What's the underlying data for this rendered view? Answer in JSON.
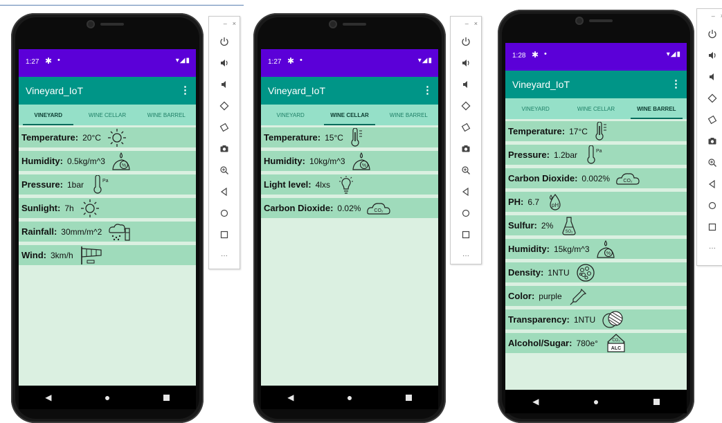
{
  "status_bar": {
    "phone1_time": "1:27",
    "phone2_time": "1:27",
    "phone3_time": "1:28",
    "gear": "✱",
    "dot": "•",
    "right": "▾◢▮"
  },
  "app": {
    "title": "Vineyard_IoT",
    "menu": "⋮"
  },
  "tabs": [
    "Vineyard",
    "Wine Cellar",
    "Wine Barrel"
  ],
  "phone1": {
    "active_tab": 0,
    "rows": [
      {
        "label": "Temperature:",
        "value": "20°C",
        "icon": "sun-icon"
      },
      {
        "label": "Humidity:",
        "value": "0.5kg/m^3",
        "icon": "humidity-icon"
      },
      {
        "label": "Pressure:",
        "value": "1bar",
        "icon": "pressure-thermometer-icon"
      },
      {
        "label": "Sunlight:",
        "value": "7h",
        "icon": "sun-icon"
      },
      {
        "label": "Rainfall:",
        "value": "30mm/m^2",
        "icon": "rainfall-icon"
      },
      {
        "label": "Wind:",
        "value": "3km/h",
        "icon": "windsock-icon"
      }
    ]
  },
  "phone2": {
    "active_tab": 1,
    "rows": [
      {
        "label": "Temperature:",
        "value": "15°C",
        "icon": "thermometer-icon"
      },
      {
        "label": "Humidity:",
        "value": "10kg/m^3",
        "icon": "humidity-icon"
      },
      {
        "label": "Light level:",
        "value": "4lxs",
        "icon": "lightbulb-icon"
      },
      {
        "label": "Carbon Dioxide:",
        "value": "0.02%",
        "icon": "co2-cloud-icon"
      }
    ]
  },
  "phone3": {
    "active_tab": 2,
    "rows": [
      {
        "label": "Temperature:",
        "value": "17°C",
        "icon": "thermometer-icon"
      },
      {
        "label": "Pressure:",
        "value": "1.2bar",
        "icon": "pressure-thermometer-icon"
      },
      {
        "label": "Carbon Dioxide:",
        "value": "0.002%",
        "icon": "co2-cloud-icon"
      },
      {
        "label": "PH:",
        "value": "6.7",
        "icon": "ph-drop-icon"
      },
      {
        "label": "Sulfur:",
        "value": "2%",
        "icon": "sulfur-flask-icon"
      },
      {
        "label": "Humidity:",
        "value": "15kg/m^3",
        "icon": "humidity-icon"
      },
      {
        "label": "Density:",
        "value": "1NTU",
        "icon": "density-icon"
      },
      {
        "label": "Color:",
        "value": "purple",
        "icon": "dropper-icon"
      },
      {
        "label": "Transparency:",
        "value": "1NTU",
        "icon": "transparency-icon"
      },
      {
        "label": "Alcohol/Sugar:",
        "value": "780e°",
        "icon": "alcohol-label-icon"
      }
    ]
  },
  "icon_text": {
    "pa": "Pa",
    "co2": "CO₂",
    "ph": "pH",
    "so2": "SO₂",
    "alc_top": "CO₂",
    "alc": "ALC",
    "pct": "%"
  },
  "emulator_controls": {
    "minimize": "–",
    "close": "×",
    "more": "···"
  },
  "sidebar_buttons": [
    "power-icon",
    "volume-up-icon",
    "volume-down-icon",
    "rotate-left-icon",
    "rotate-right-icon",
    "camera-icon",
    "zoom-icon",
    "back-icon",
    "home-icon",
    "overview-icon",
    "more-icon"
  ],
  "nav": {
    "back": "◀",
    "home": "●"
  },
  "colors": {
    "status_bar": "#5b00d8",
    "app_bar": "#009587",
    "tabs": "#95e0c8",
    "row": "#9fdbbb",
    "screen": "#dbf0e1"
  }
}
